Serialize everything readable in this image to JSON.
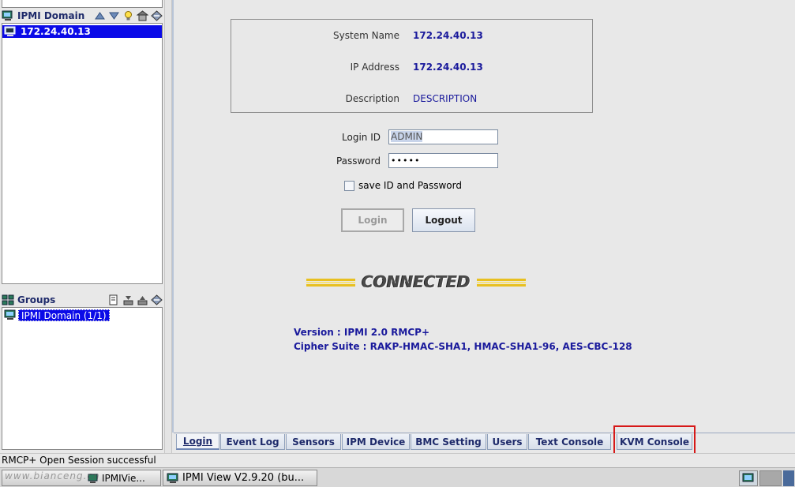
{
  "sidebar": {
    "domain_header": "IPMI Domain",
    "domain_items": [
      "172.24.40.13"
    ],
    "groups_header": "Groups",
    "group_items": [
      "IPMI Domain (1/1)"
    ]
  },
  "info": {
    "system_name_label": "System Name",
    "system_name_value": "172.24.40.13",
    "ip_label": "IP Address",
    "ip_value": "172.24.40.13",
    "desc_label": "Description",
    "desc_value": "DESCRIPTION"
  },
  "login": {
    "id_label": "Login ID",
    "id_value": "ADMIN",
    "password_label": "Password",
    "password_value": "•••••",
    "save_label": "save ID and Password",
    "login_button": "Login",
    "logout_button": "Logout"
  },
  "connection": {
    "status": "CONNECTED",
    "version_line": "Version : IPMI 2.0 RMCP+",
    "cipher_line": "Cipher Suite : RAKP-HMAC-SHA1, HMAC-SHA1-96, AES-CBC-128"
  },
  "tabs": [
    {
      "label": "Login"
    },
    {
      "label": "Event Log"
    },
    {
      "label": "Sensors"
    },
    {
      "label": "IPM Device"
    },
    {
      "label": "BMC Setting"
    },
    {
      "label": "Users"
    },
    {
      "label": "Text Console"
    },
    {
      "label": "KVM Console"
    }
  ],
  "status_bar": "RMCP+ Open Session successful",
  "taskbar": {
    "item1": "IPMIVie...",
    "item2": "IPMI View V2.9.20 (bu..."
  },
  "watermark": "www.bianceng.cn",
  "colors": {
    "selection": "#0a0ae8",
    "value_text": "#1a1a9c",
    "highlight_box": "#d61818"
  }
}
